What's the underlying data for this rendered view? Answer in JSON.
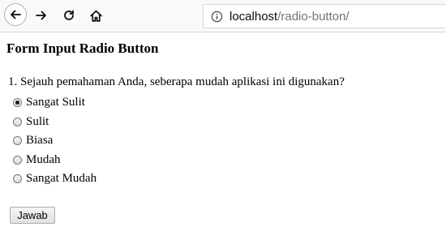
{
  "browser": {
    "url_host": "localhost",
    "url_path": "/radio-button/"
  },
  "page": {
    "title": "Form Input Radio Button",
    "question": "1. Sejauh pemahaman Anda, seberapa mudah aplikasi ini digunakan?",
    "options": [
      {
        "label": "Sangat Sulit",
        "checked": true
      },
      {
        "label": "Sulit",
        "checked": false
      },
      {
        "label": "Biasa",
        "checked": false
      },
      {
        "label": "Mudah",
        "checked": false
      },
      {
        "label": "Sangat Mudah",
        "checked": false
      }
    ],
    "submit_label": "Jawab"
  },
  "icons": [
    "back-icon",
    "forward-icon",
    "reload-icon",
    "home-icon",
    "info-icon"
  ]
}
